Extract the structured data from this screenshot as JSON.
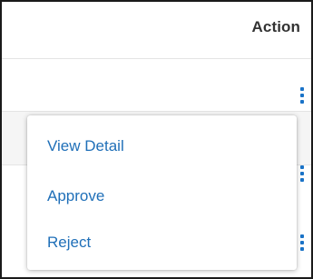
{
  "table": {
    "header": {
      "action_label": "Action"
    },
    "rows": [
      {
        "menu_icon": "more-vertical-icon"
      },
      {
        "menu_icon": "more-vertical-icon"
      },
      {
        "menu_icon": "more-vertical-icon"
      }
    ]
  },
  "action_menu": {
    "items": [
      {
        "label": "View Detail"
      },
      {
        "label": "Approve"
      },
      {
        "label": "Reject"
      }
    ]
  },
  "colors": {
    "accent": "#1a73c8",
    "link_text": "#1f6fb8",
    "header_text": "#333333",
    "border": "#1a1a1a",
    "row_alt_bg": "#f5f5f5"
  }
}
